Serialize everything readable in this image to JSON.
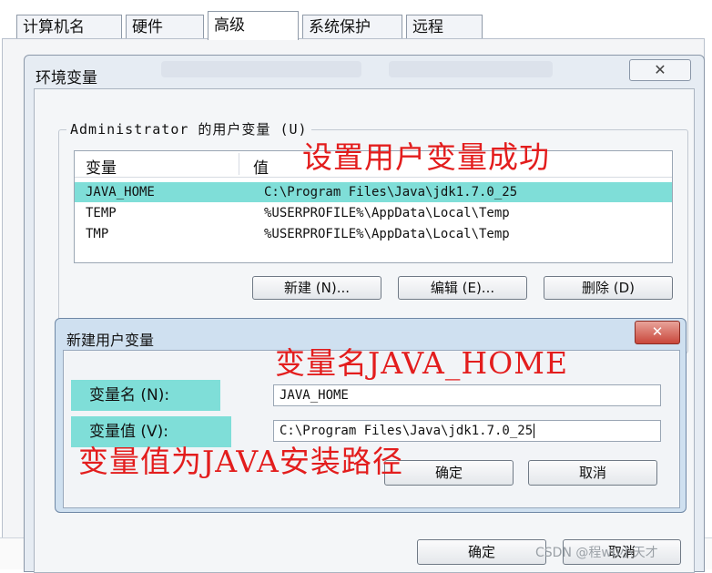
{
  "tabs": [
    "计算机名",
    "硬件",
    "高级",
    "系统保护",
    "远程"
  ],
  "active_tab": "高级",
  "env_dialog": {
    "title": "环境变量",
    "close_glyph": "✕",
    "user_group_label": "Administrator 的用户变量 (U)",
    "columns": [
      "变量",
      "值"
    ],
    "rows": [
      {
        "name": "JAVA_HOME",
        "value": "C:\\Program Files\\Java\\jdk1.7.0_25",
        "selected": true
      },
      {
        "name": "TEMP",
        "value": "%USERPROFILE%\\AppData\\Local\\Temp",
        "selected": false
      },
      {
        "name": "TMP",
        "value": "%USERPROFILE%\\AppData\\Local\\Temp",
        "selected": false
      }
    ],
    "buttons": {
      "new": "新建 (N)...",
      "edit": "编辑 (E)...",
      "delete": "删除 (D)"
    },
    "ok": "确定",
    "cancel": "取消"
  },
  "new_var_dialog": {
    "title": "新建用户变量",
    "close_glyph": "✕",
    "name_label": "变量名 (N):",
    "name_value": "JAVA_HOME",
    "value_label": "变量值 (V):",
    "value_value": "C:\\Program Files\\Java\\jdk1.7.0_25",
    "ok": "确定",
    "cancel": "取消"
  },
  "annotations": {
    "success": "设置用户变量成功",
    "var_name": "变量名JAVA_HOME",
    "var_value": "变量值为JAVA安装路径"
  },
  "watermark": "CSDN @程wu小天才",
  "colors": {
    "highlight": "#7fded8",
    "annotation": "#e31d1d"
  }
}
